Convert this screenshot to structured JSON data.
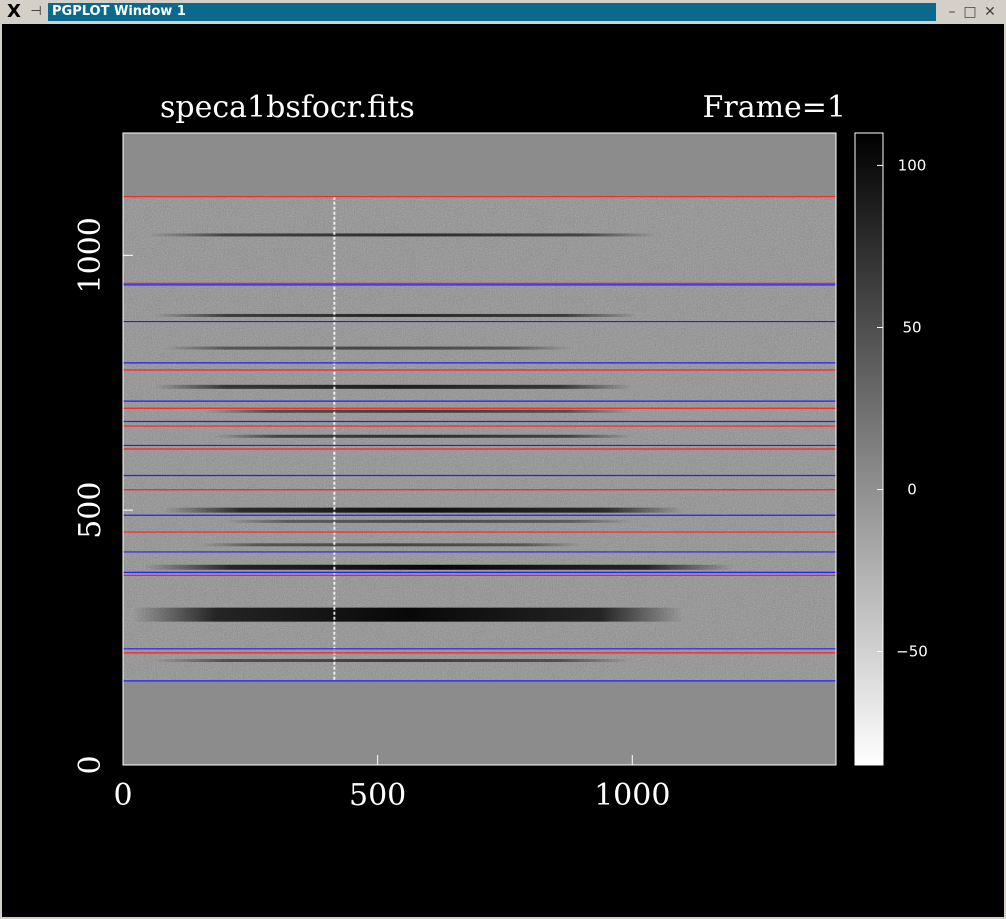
{
  "window": {
    "title": "PGPLOT Window 1",
    "close_glyph": "X",
    "pin_glyph": "⊣",
    "minimize_glyph": "–",
    "maximize_glyph": "□",
    "closebtn_glyph": "✕"
  },
  "plot": {
    "title_left": "speca1bsfocr.fits",
    "title_right": "Frame=1",
    "background_color": "#000000",
    "image_fill_color": "#8c8c8c",
    "trace_color_red": "#ff2020",
    "trace_color_blue": "#2020ff"
  },
  "chart_data": {
    "type": "heatmap",
    "xlim": [
      0,
      1400
    ],
    "ylim": [
      0,
      1240
    ],
    "xticks": [
      0,
      500,
      1000
    ],
    "yticks": [
      0,
      500,
      1000
    ],
    "colorbar": {
      "min": -85,
      "max": 110,
      "ticks": [
        100,
        50,
        0,
        -50
      ]
    },
    "red_lines_y": [
      1115,
      945,
      775,
      700,
      665,
      620,
      540,
      457,
      372,
      220
    ],
    "blue_lines_y": [
      942,
      870,
      789,
      714,
      674,
      627,
      568,
      490,
      418,
      378,
      228,
      165
    ],
    "spectra": [
      {
        "y": 1040,
        "x0": 50,
        "x1": 1050,
        "strength": 0.7,
        "width": 3
      },
      {
        "y": 882,
        "x0": 60,
        "x1": 1010,
        "strength": 0.75,
        "width": 3
      },
      {
        "y": 818,
        "x0": 80,
        "x1": 880,
        "strength": 0.55,
        "width": 3
      },
      {
        "y": 742,
        "x0": 60,
        "x1": 1000,
        "strength": 0.8,
        "width": 4
      },
      {
        "y": 694,
        "x0": 160,
        "x1": 1000,
        "strength": 0.6,
        "width": 3
      },
      {
        "y": 645,
        "x0": 180,
        "x1": 1000,
        "strength": 0.7,
        "width": 3
      },
      {
        "y": 500,
        "x0": 80,
        "x1": 1100,
        "strength": 0.9,
        "width": 5
      },
      {
        "y": 478,
        "x0": 200,
        "x1": 1000,
        "strength": 0.5,
        "width": 3
      },
      {
        "y": 432,
        "x0": 150,
        "x1": 900,
        "strength": 0.55,
        "width": 3
      },
      {
        "y": 388,
        "x0": 40,
        "x1": 1200,
        "strength": 0.95,
        "width": 5
      },
      {
        "y": 295,
        "x0": 20,
        "x1": 1100,
        "strength": 0.95,
        "width": 14
      },
      {
        "y": 205,
        "x0": 60,
        "x1": 1000,
        "strength": 0.6,
        "width": 3
      }
    ],
    "bad_column_x": 415,
    "data_rows": [
      165,
      1115
    ]
  }
}
